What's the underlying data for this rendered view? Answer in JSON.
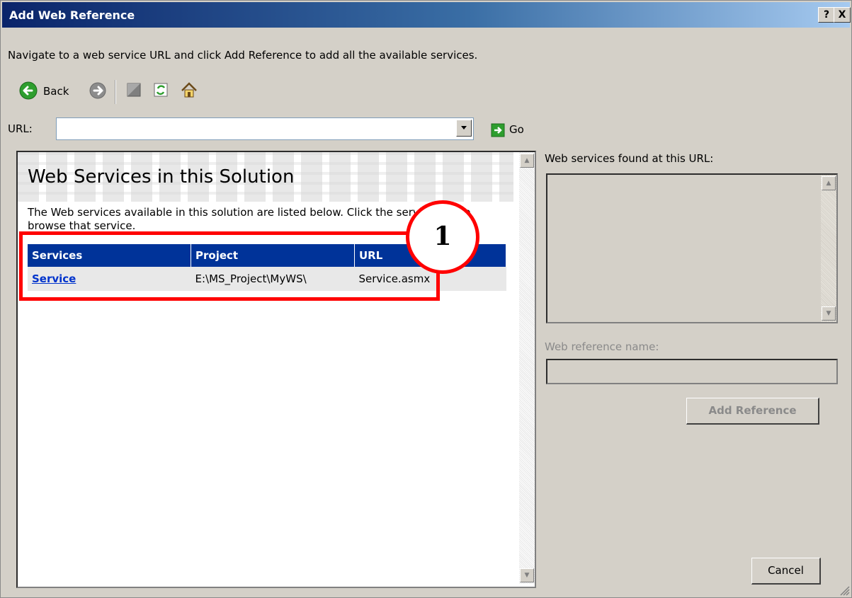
{
  "window": {
    "title": "Add Web Reference",
    "help_glyph": "?",
    "close_glyph": "X"
  },
  "instruction": "Navigate to a web service URL and click Add Reference to add all the available services.",
  "toolbar": {
    "back_label": "Back",
    "icons": [
      "back-arrow-icon",
      "forward-arrow-icon",
      "stop-icon",
      "refresh-icon",
      "home-icon"
    ]
  },
  "url_bar": {
    "label": "URL:",
    "value": "",
    "go_label": "Go"
  },
  "browser_panel": {
    "title": "Web Services in this Solution",
    "description": "The Web services available in this solution are listed below. Click the service link to browse that service.",
    "table": {
      "headers": [
        "Services",
        "Project",
        "URL"
      ],
      "rows": [
        {
          "service": "Service",
          "project": "E:\\MS_Project\\MyWS\\",
          "url": "Service.asmx"
        }
      ]
    }
  },
  "right_panel": {
    "found_label": "Web services found at this URL:",
    "ref_name_label": "Web reference name:",
    "ref_name_value": "",
    "add_reference_label": "Add Reference",
    "cancel_label": "Cancel"
  },
  "annotation": {
    "callout_number": "1",
    "color": "#ff0000"
  }
}
